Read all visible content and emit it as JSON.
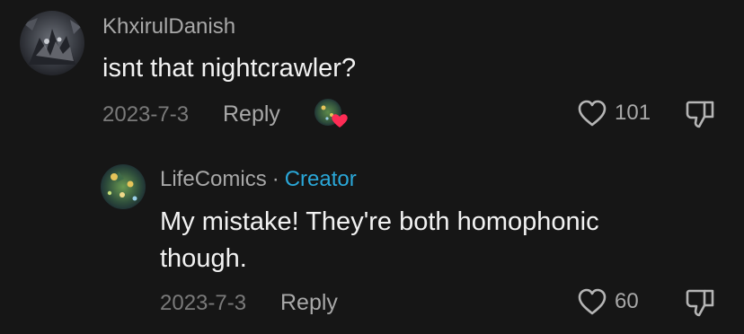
{
  "comments": [
    {
      "username": "KhxirulDanish",
      "text": "isnt that nightcrawler?",
      "date": "2023-7-3",
      "reply_label": "Reply",
      "likes": "101"
    }
  ],
  "reply": {
    "username": "LifeComics",
    "separator": "·",
    "badge": "Creator",
    "text": "My mistake! They're both homophonic though.",
    "date": "2023-7-3",
    "reply_label": "Reply",
    "likes": "60"
  },
  "colors": {
    "background": "#161616",
    "creator_badge": "#2aa7d8",
    "heart_badge": "#fe2c55"
  },
  "icons": {
    "like": "heart-outline-icon",
    "dislike": "thumbs-down-icon",
    "creator_liked": "creator-liked-heart-icon"
  }
}
